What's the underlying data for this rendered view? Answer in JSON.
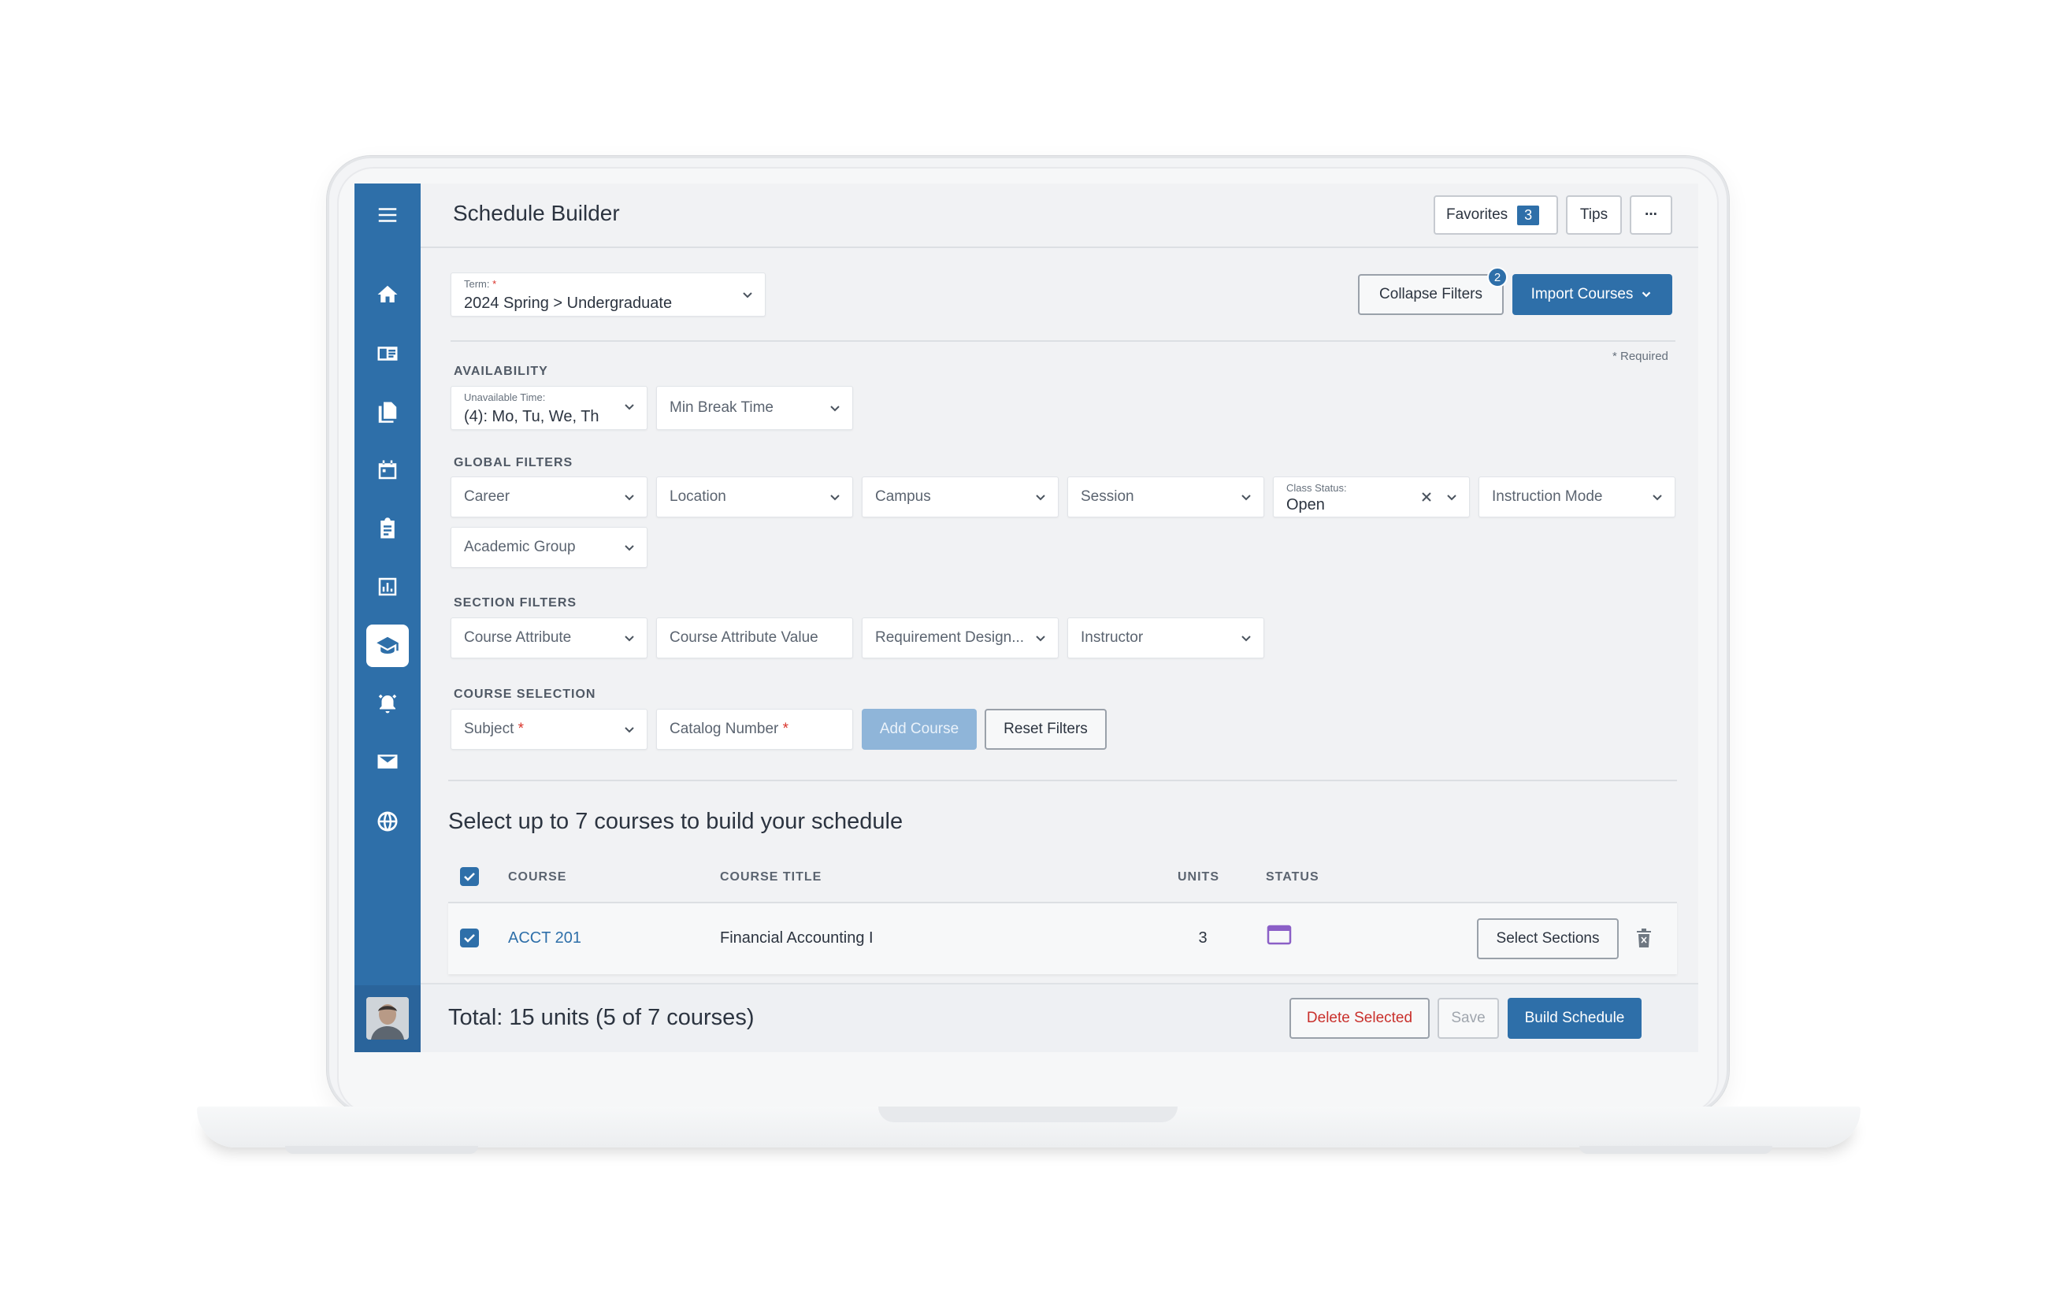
{
  "header": {
    "title": "Schedule Builder",
    "favorites_label": "Favorites",
    "favorites_count": "3",
    "tips_label": "Tips",
    "more_label": "···"
  },
  "term": {
    "label": "Term:",
    "required_mark": "*",
    "value": "2024 Spring > Undergraduate"
  },
  "actions": {
    "collapse_filters": "Collapse Filters",
    "collapse_badge": "2",
    "import_courses": "Import Courses",
    "required_note": "* Required"
  },
  "availability": {
    "section_label": "AVAILABILITY",
    "unavailable_label": "Unavailable Time:",
    "unavailable_value": "(4): Mo, Tu, We, Th",
    "min_break": "Min Break Time"
  },
  "global_filters": {
    "section_label": "GLOBAL FILTERS",
    "career": "Career",
    "location": "Location",
    "campus": "Campus",
    "session": "Session",
    "class_status_label": "Class Status:",
    "class_status_value": "Open",
    "instruction_mode": "Instruction Mode",
    "academic_group": "Academic Group"
  },
  "section_filters": {
    "section_label": "SECTION FILTERS",
    "course_attribute": "Course Attribute",
    "course_attribute_value": "Course Attribute Value",
    "requirement_designation": "Requirement Design...",
    "instructor": "Instructor"
  },
  "course_selection": {
    "section_label": "COURSE SELECTION",
    "subject": "Subject",
    "catalog_number": "Catalog Number",
    "required_mark": "*",
    "add_course": "Add Course",
    "reset_filters": "Reset Filters"
  },
  "courses": {
    "heading": "Select up to 7 courses to build your schedule",
    "columns": [
      "COURSE",
      "COURSE TITLE",
      "UNITS",
      "STATUS"
    ],
    "rows": [
      {
        "course": "ACCT 201",
        "title": "Financial Accounting I",
        "units": "3",
        "status_icon": "window-icon",
        "action": "Select Sections"
      }
    ]
  },
  "footer": {
    "total": "Total: 15 units (5 of 7 courses)",
    "delete_selected": "Delete Selected",
    "save": "Save",
    "build_schedule": "Build Schedule"
  },
  "sidebar": {
    "icons": [
      "menu-icon",
      "home-icon",
      "catalog-icon",
      "documents-icon",
      "calendar-icon",
      "clipboard-icon",
      "chart-icon",
      "graduation-cap-icon",
      "alarm-icon",
      "mail-icon",
      "globe-icon"
    ]
  },
  "colors": {
    "brand": "#2e6fa9",
    "danger": "#c9302c",
    "required": "#d9342b",
    "status_icon": "#8b5fc7"
  }
}
